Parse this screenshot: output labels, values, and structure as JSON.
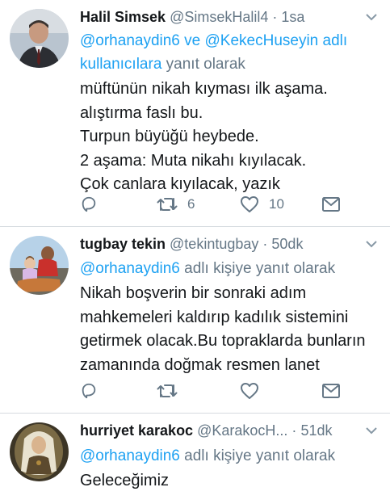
{
  "tweets": [
    {
      "name": "Halil Simsek",
      "handle": "@SimsekHalil4",
      "separator": "·",
      "time": "1sa",
      "reply_prefix_mention_1": "@orhanaydin6",
      "reply_connector": " ve ",
      "reply_prefix_mention_2": "@KekecHuseyin",
      "reply_mention_suffix": " adlı kullanıcılara",
      "reply_suffix": " yanıt olarak",
      "body": "müftünün nikah kıyması ilk aşama.\nalıştırma  faslı bu.\nTurpun büyüğü heybede.\n2 aşama: Muta nikahı kıyılacak.\nÇok canlara kıyılacak, yazık",
      "reply_count": "",
      "retweet_count": "6",
      "like_count": "10"
    },
    {
      "name": "tugbay tekin",
      "handle": "@tekintugbay",
      "separator": "·",
      "time": "50dk",
      "reply_mention": "@orhanaydin6",
      "reply_suffix": " adlı kişiye yanıt olarak",
      "body": "Nikah boşverin bir sonraki adım\nmahkemeleri kaldırıp kadılık sistemini\ngetirmek olacak.Bu topraklarda bunların\nzamanında doğmak resmen lanet",
      "reply_count": "",
      "retweet_count": "",
      "like_count": ""
    },
    {
      "name": "hurriyet karakoc",
      "handle": "@KarakocH...",
      "separator": "·",
      "time": "51dk",
      "reply_mention": "@orhanaydin6",
      "reply_suffix": " adlı kişiye yanıt olarak",
      "body": "Geleceğimiz"
    }
  ],
  "icons": {
    "reply": "reply-icon",
    "retweet": "retweet-icon",
    "like": "heart-icon",
    "dm": "envelope-icon",
    "caret": "chevron-down-icon"
  },
  "colors": {
    "link": "#1da1f2",
    "muted": "#657786",
    "text": "#14171a",
    "divider": "#d6dbe0"
  }
}
